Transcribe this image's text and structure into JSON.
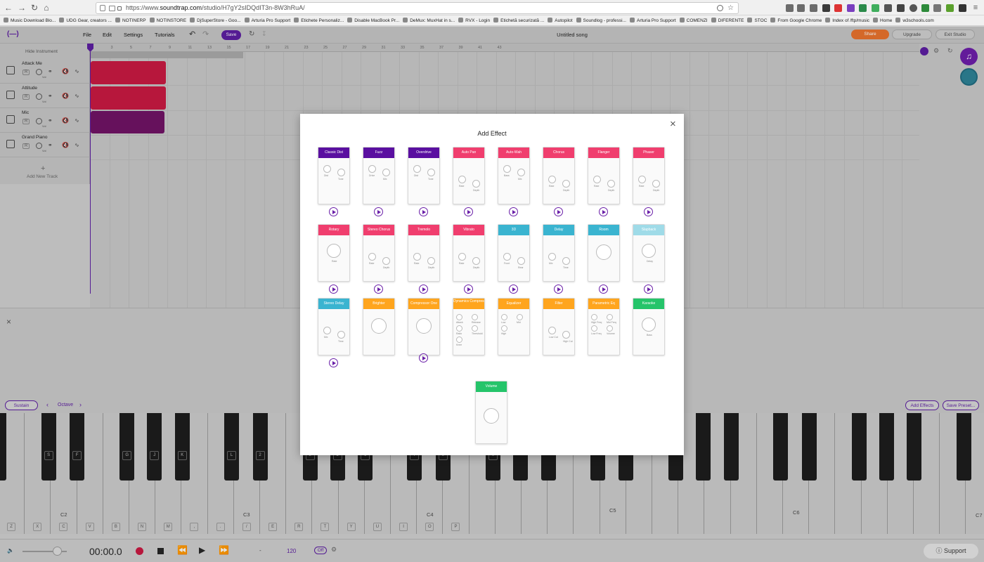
{
  "browser": {
    "url_prefix": "https://www.",
    "url_domain": "soundtrap.com",
    "url_path": "/studio/H7gY2sIDQdIT3n-8W3hRuA/",
    "bookmarks": [
      "Music Download Blo...",
      "UDG Gear, creators ...",
      "NOTINERP",
      "NOTINSTORE",
      "DjSuperStore - Goo...",
      "Arturia Pro Support",
      "Etichete Personaliz...",
      "Disable MacBook Pr...",
      "DeMux: MuxHat in s...",
      "RVX - Login",
      "Etichetă securizată ...",
      "Autopilot",
      "Soundlog - professi...",
      "Arturia Pro Support",
      "COMENZI",
      "DIFERENTE",
      "STOC",
      "From Google Chrome",
      "Index of /ftp/music",
      "Home",
      "w3schools.com"
    ]
  },
  "header": {
    "logo": "(—)",
    "menu": [
      "File",
      "Edit",
      "Settings",
      "Tutorials"
    ],
    "save": "Save",
    "song_title": "Untitled song",
    "share": "Share",
    "upgrade": "Upgrade",
    "exit": "Exit Studio"
  },
  "tracks_panel": {
    "hide_instrument": "Hide Instrument",
    "add_track": "Add New Track",
    "rec": "R",
    "vol": "Vol",
    "tracks": [
      {
        "name": "Attack Me",
        "icon": "grid-icon"
      },
      {
        "name": "Attitude",
        "icon": "drum-icon"
      },
      {
        "name": "Mic",
        "icon": "mic-icon"
      },
      {
        "name": "Grand Piano",
        "icon": "piano-icon"
      }
    ]
  },
  "ruler": [
    "1",
    "3",
    "5",
    "7",
    "9",
    "11",
    "13",
    "15",
    "17",
    "19",
    "21",
    "23",
    "25",
    "27",
    "29",
    "31",
    "33",
    "35",
    "37",
    "39",
    "41",
    "43"
  ],
  "keyboard": {
    "sustain": "Sustain",
    "octave": "Octave",
    "add_effects": "Add Effects",
    "save_preset": "Save Preset...",
    "black_labels": [
      "S",
      "F",
      "G",
      "J",
      "K",
      "L",
      "2",
      "3",
      "5",
      "6",
      "7",
      "9",
      "0"
    ],
    "white_labels": [
      "Z",
      "X",
      "C",
      "V",
      "B",
      "N",
      "M",
      ",",
      ".",
      "/",
      "E",
      "R",
      "T",
      "Y",
      "U",
      "I",
      "O",
      "P"
    ],
    "octave_notes": [
      "C2",
      "C3",
      "C4",
      "C5",
      "C6",
      "C7"
    ]
  },
  "transport": {
    "time": "00:00.0",
    "dash": "-",
    "bpm": "120",
    "metronome": "Off",
    "support": "Support"
  },
  "modal": {
    "title": "Add Effect",
    "close": "×",
    "effects": [
      {
        "name": "Classic Dist",
        "color": "#5a0fa0",
        "knobs": [
          "Dist",
          "Tone"
        ]
      },
      {
        "name": "Fuzz",
        "color": "#5a0fa0",
        "knobs": [
          "Drive",
          "Mix"
        ]
      },
      {
        "name": "Overdrive",
        "color": "#5a0fa0",
        "knobs": [
          "Dist",
          "Tone"
        ]
      },
      {
        "name": "Auto Pan",
        "color": "#f03e6e",
        "knobs": [
          "Rate",
          "Depth"
        ]
      },
      {
        "name": "Auto-Wah",
        "color": "#f03e6e",
        "knobs": [
          "Bass",
          "Mix"
        ]
      },
      {
        "name": "Chorus",
        "color": "#f03e6e",
        "knobs": [
          "Rate",
          "Depth"
        ]
      },
      {
        "name": "Flanger",
        "color": "#f03e6e",
        "knobs": [
          "Rate",
          "Depth"
        ]
      },
      {
        "name": "Phaser",
        "color": "#f03e6e",
        "knobs": [
          "Rate",
          "Depth"
        ]
      },
      {
        "name": "Rotary",
        "color": "#f03e6e",
        "knobs": [
          "Rate"
        ]
      },
      {
        "name": "Stereo Chorus",
        "color": "#f03e6e",
        "knobs": [
          "Rate",
          "Depth"
        ]
      },
      {
        "name": "Tremolo",
        "color": "#f03e6e",
        "knobs": [
          "Rate",
          "Depth"
        ]
      },
      {
        "name": "Vibrato",
        "color": "#f03e6e",
        "knobs": [
          "Rate",
          "Depth"
        ]
      },
      {
        "name": "3D",
        "color": "#3ab4d0",
        "knobs": [
          "Front",
          "Rear"
        ]
      },
      {
        "name": "Delay",
        "color": "#3ab4d0",
        "knobs": [
          "Mix",
          "Time"
        ]
      },
      {
        "name": "Room",
        "color": "#3ab4d0",
        "knobs": []
      },
      {
        "name": "Slapback",
        "color": "#9fdbe8",
        "knobs": [
          "Delay"
        ]
      },
      {
        "name": "Stereo Delay",
        "color": "#3ab4d0",
        "knobs": [
          "Mix",
          "Time"
        ]
      },
      {
        "name": "Brighter",
        "color": "#ffa51e",
        "knobs": []
      },
      {
        "name": "Compressor One",
        "color": "#ffa51e",
        "knobs": []
      },
      {
        "name": "Dynamics Compressor",
        "color": "#ffa51e",
        "knobs": [
          "Attack",
          "Release",
          "Ratio",
          "Threshold",
          "Knee"
        ]
      },
      {
        "name": "Equalizer",
        "color": "#ffa51e",
        "knobs": [
          "Low",
          "Mid",
          "High"
        ]
      },
      {
        "name": "Filter",
        "color": "#ffa51e",
        "knobs": [
          "Low Cut",
          "High Cut"
        ]
      },
      {
        "name": "Parametric Eq",
        "color": "#ffa51e",
        "knobs": [
          "High Freq",
          "Mid Freq",
          "Low Freq",
          "Volume"
        ]
      },
      {
        "name": "Karaoke",
        "color": "#25c46a",
        "knobs": [
          "Bass"
        ]
      },
      {
        "name": "Volume",
        "color": "#25c46a",
        "knobs": []
      }
    ]
  }
}
